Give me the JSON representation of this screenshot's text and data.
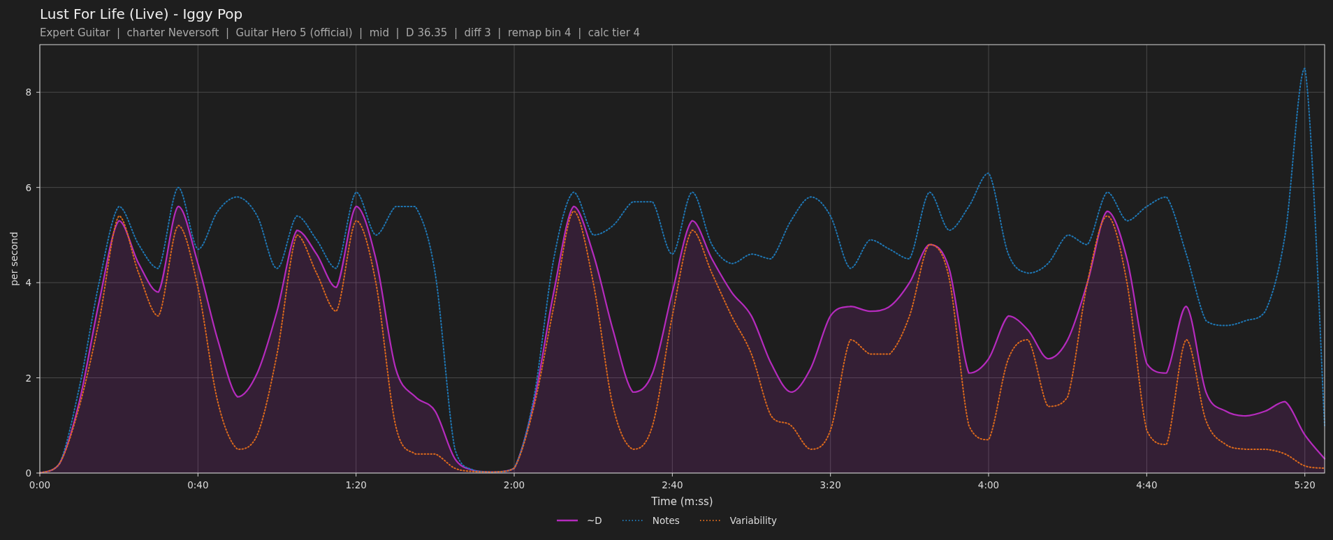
{
  "chart": {
    "title": "Lust For Life (Live) - Iggy Pop",
    "subtitle": "Expert Guitar  |  charter Neversoft  |  Guitar Hero 5 (official)  |  mid  |  D 36.35  |  diff 3  |  remap bin 4  |  calc tier 4",
    "chart_data": {
      "type": "line",
      "xlabel": "Time (m:ss)",
      "ylabel": "per second",
      "x": [
        0,
        5,
        10,
        15,
        20,
        25,
        30,
        35,
        40,
        45,
        50,
        55,
        60,
        65,
        70,
        75,
        80,
        85,
        90,
        95,
        100,
        105,
        110,
        115,
        120,
        125,
        130,
        135,
        140,
        145,
        150,
        155,
        160,
        165,
        170,
        175,
        180,
        185,
        190,
        195,
        200,
        205,
        210,
        215,
        220,
        225,
        230,
        235,
        240,
        245,
        250,
        255,
        260,
        265,
        270,
        275,
        280,
        285,
        290,
        295,
        300,
        305,
        310,
        315,
        320,
        325
      ],
      "series": [
        {
          "name": "~D",
          "color": "#b52bbd",
          "type": "area",
          "line_style": "solid",
          "values": [
            0,
            0.2,
            1.5,
            3.6,
            5.3,
            4.4,
            3.8,
            5.6,
            4.4,
            2.8,
            1.6,
            2.1,
            3.4,
            5.1,
            4.6,
            3.9,
            5.6,
            4.5,
            2.2,
            1.6,
            1.3,
            0.3,
            0.05,
            0.02,
            0.1,
            1.5,
            3.8,
            5.6,
            4.6,
            3.0,
            1.7,
            2.1,
            3.8,
            5.3,
            4.5,
            3.8,
            3.3,
            2.3,
            1.7,
            2.2,
            3.3,
            3.5,
            3.4,
            3.5,
            4.0,
            4.8,
            4.3,
            2.1,
            2.4,
            3.3,
            3.0,
            2.4,
            2.8,
            4.0,
            5.5,
            4.5,
            2.3,
            2.1,
            3.5,
            1.7,
            1.3,
            1.2,
            1.3,
            1.5,
            0.8,
            0.3
          ]
        },
        {
          "name": "Notes",
          "color": "#1f77b4",
          "type": "line",
          "line_style": "dotted",
          "values": [
            0,
            0.2,
            1.8,
            4.0,
            5.6,
            4.8,
            4.3,
            6.0,
            4.7,
            5.5,
            5.8,
            5.4,
            4.3,
            5.4,
            4.9,
            4.3,
            5.9,
            5.0,
            5.6,
            5.6,
            4.2,
            0.5,
            0.05,
            0.02,
            0.1,
            1.6,
            4.5,
            5.9,
            5.0,
            5.2,
            5.7,
            5.7,
            4.6,
            5.9,
            4.8,
            4.4,
            4.6,
            4.5,
            5.3,
            5.8,
            5.4,
            4.3,
            4.9,
            4.7,
            4.5,
            5.9,
            5.1,
            5.6,
            6.3,
            4.6,
            4.2,
            4.4,
            5.0,
            4.8,
            5.9,
            5.3,
            5.6,
            5.8,
            4.6,
            3.2,
            3.1,
            3.2,
            3.4,
            5.0,
            8.5,
            1.0
          ]
        },
        {
          "name": "Variability",
          "color": "#dc6a1c",
          "type": "line",
          "line_style": "dotted",
          "values": [
            0,
            0.2,
            1.4,
            3.2,
            5.4,
            4.2,
            3.3,
            5.2,
            3.9,
            1.5,
            0.5,
            0.8,
            2.5,
            5.0,
            4.2,
            3.4,
            5.3,
            4.0,
            1.0,
            0.4,
            0.4,
            0.1,
            0.03,
            0.02,
            0.1,
            1.4,
            3.5,
            5.5,
            4.0,
            1.4,
            0.5,
            1.0,
            3.3,
            5.1,
            4.2,
            3.3,
            2.5,
            1.2,
            1.0,
            0.5,
            0.9,
            2.8,
            2.5,
            2.5,
            3.3,
            4.8,
            4.1,
            1.0,
            0.7,
            2.4,
            2.8,
            1.4,
            1.6,
            4.0,
            5.4,
            4.0,
            0.9,
            0.6,
            2.8,
            1.1,
            0.6,
            0.5,
            0.5,
            0.4,
            0.15,
            0.1
          ]
        }
      ],
      "grid": true,
      "xlim": [
        0,
        325
      ],
      "ylim": [
        0,
        9
      ],
      "xticks": [
        {
          "value": 0,
          "label": "0:00"
        },
        {
          "value": 40,
          "label": "0:40"
        },
        {
          "value": 80,
          "label": "1:20"
        },
        {
          "value": 120,
          "label": "2:00"
        },
        {
          "value": 160,
          "label": "2:40"
        },
        {
          "value": 200,
          "label": "3:20"
        },
        {
          "value": 240,
          "label": "4:00"
        },
        {
          "value": 280,
          "label": "4:40"
        },
        {
          "value": 320,
          "label": "5:20"
        }
      ],
      "yticks": [
        0,
        2,
        4,
        6,
        8
      ]
    }
  }
}
